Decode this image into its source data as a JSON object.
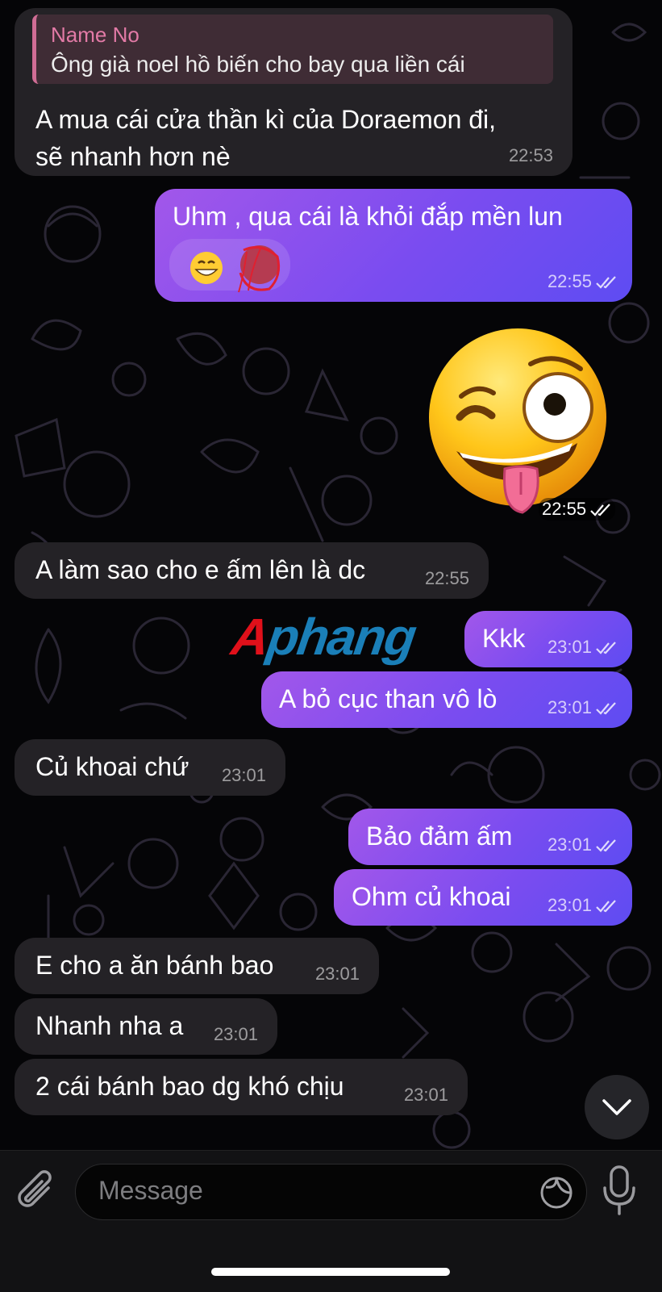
{
  "messages": {
    "m1": {
      "reply_name": "Name No",
      "reply_text": "Ông già noel hồ biến cho bay qua liền cái",
      "line1": "A mua cái cửa thần kì của Doraemon đi,",
      "line2": "sẽ nhanh hơn nè",
      "time": "22:53"
    },
    "m2": {
      "text": "Uhm , qua cái là khỏi đắp mền lun",
      "time": "22:55"
    },
    "m3": {
      "time": "22:55"
    },
    "m4": {
      "text": "A làm sao cho e ấm lên là dc",
      "time": "22:55"
    },
    "m5": {
      "text": "Kkk",
      "time": "23:01"
    },
    "m6": {
      "text": "A bỏ cục than vô lò",
      "time": "23:01"
    },
    "m7": {
      "text": "Củ khoai chứ",
      "time": "23:01"
    },
    "m8": {
      "text": "Bảo đảm ấm",
      "time": "23:01"
    },
    "m9": {
      "text": "Ohm củ khoai",
      "time": "23:01"
    },
    "m10": {
      "text": "E cho a ăn bánh bao",
      "time": "23:01"
    },
    "m11": {
      "text": "Nhanh nha a",
      "time": "23:01"
    },
    "m12": {
      "text": "2 cái bánh bao dg khó chịu",
      "time": "23:01"
    }
  },
  "watermark": {
    "part1": "A",
    "part2": "phang"
  },
  "input": {
    "placeholder": "Message"
  },
  "icons": {
    "attach": "paperclip-icon",
    "sticker": "sticker-icon",
    "mic": "microphone-icon",
    "scroll": "chevron-down-icon",
    "read": "double-check-icon"
  },
  "colors": {
    "outgoing_start": "#a257ea",
    "outgoing_end": "#5e4cf2",
    "incoming": "#242226",
    "reply_name": "#e27aa6"
  }
}
